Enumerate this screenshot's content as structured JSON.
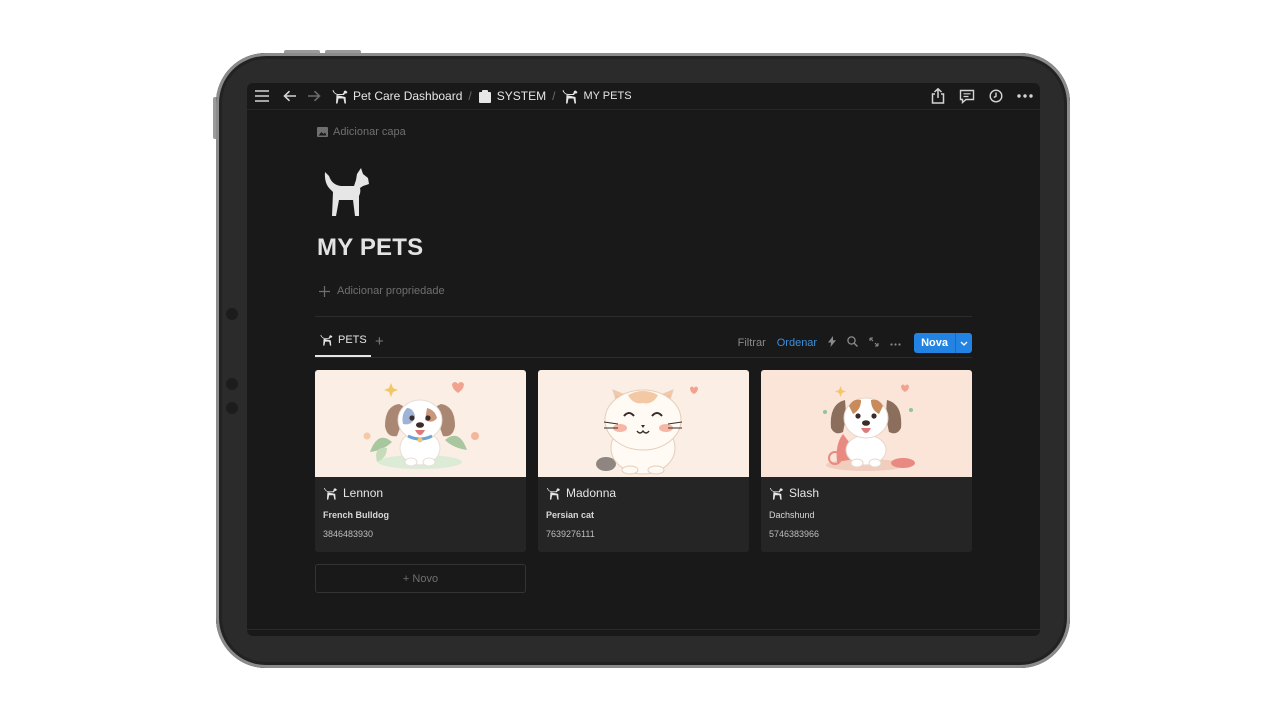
{
  "topbar": {
    "menu_icon": "hamburger-icon",
    "back_icon": "arrow-left-icon",
    "forward_icon": "arrow-right-icon",
    "breadcrumbs": [
      {
        "label": "Pet Care Dashboard",
        "icon": "dog-icon"
      },
      {
        "label": "SYSTEM",
        "icon": "clipboard-icon"
      },
      {
        "label": "MY PETS",
        "icon": "dog-icon"
      }
    ],
    "separator": "/",
    "actions": [
      "share-icon",
      "comment-icon",
      "clock-icon",
      "more-icon"
    ]
  },
  "page": {
    "add_cover": "Adicionar capa",
    "icon": "dog-icon",
    "title": "MY PETS",
    "add_property": "Adicionar propriedade"
  },
  "database": {
    "view_tab": "PETS",
    "add_view": "+",
    "filter": "Filtrar",
    "sort": "Ordenar",
    "new_button": "Nova",
    "accent_color": "#2383e2"
  },
  "cards": [
    {
      "name": "Lennon",
      "breed": "French Bulldog",
      "phone": "3846483930",
      "image": "cartoon-puppy"
    },
    {
      "name": "Madonna",
      "breed": "Persian cat",
      "phone": "7639276111",
      "image": "cartoon-cat"
    },
    {
      "name": "Slash",
      "breed": "Dachshund",
      "phone": "5746383966",
      "image": "cartoon-beagle"
    }
  ],
  "new_card": "+ Novo"
}
